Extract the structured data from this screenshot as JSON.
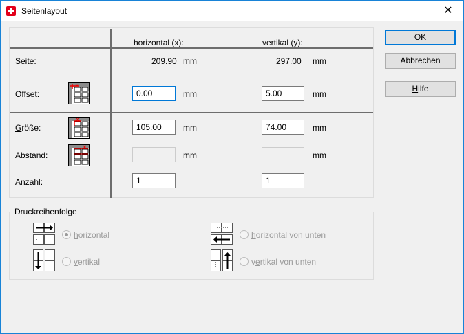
{
  "window": {
    "title": "Seitenlayout",
    "close_glyph": "✕"
  },
  "columns": {
    "horizontal": "horizontal (x):",
    "vertical": "vertikal (y):"
  },
  "unit": "mm",
  "rows": {
    "seite": {
      "label": "Seite:",
      "x": "209.90",
      "y": "297.00"
    },
    "offset": {
      "label_pre": "",
      "label_u": "O",
      "label_post": "ffset:",
      "x": "0.00",
      "y": "5.00"
    },
    "groesse": {
      "label_pre": "",
      "label_u": "G",
      "label_post": "röße:",
      "x": "105.00",
      "y": "74.00"
    },
    "abstand": {
      "label_pre": "",
      "label_u": "A",
      "label_post": "bstand:",
      "x": "",
      "y": ""
    },
    "anzahl": {
      "label_pre": "A",
      "label_u": "n",
      "label_post": "zahl:",
      "x": "1",
      "y": "1"
    }
  },
  "buttons": {
    "ok": "OK",
    "cancel": "Abbrechen",
    "help_u": "H",
    "help_rest": "ilfe"
  },
  "print_order": {
    "title": "Druckreihenfolge",
    "horizontal": {
      "u": "h",
      "rest": "orizontal",
      "checked": true
    },
    "vertikal": {
      "u": "v",
      "rest": "ertikal",
      "checked": false
    },
    "horizontal_unten": {
      "u": "h",
      "rest": "orizontal von unten",
      "checked": false
    },
    "vertikal_unten": {
      "pre": "v",
      "u": "e",
      "rest": "rtikal von unten",
      "checked": false
    }
  },
  "colors": {
    "accent": "#0078d7",
    "titlebar_border": "#1883d7",
    "icon_red": "#e2001a"
  },
  "icons": [
    "app-swiss-icon",
    "close-icon",
    "page-offset-icon",
    "page-size-icon",
    "page-spacing-icon",
    "order-horizontal-icon",
    "order-vertical-icon",
    "order-horizontal-bottom-icon",
    "order-vertical-bottom-icon"
  ]
}
